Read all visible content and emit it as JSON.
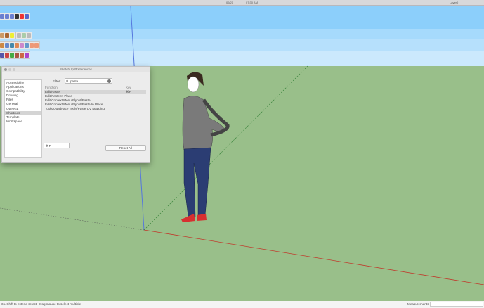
{
  "menubar": {
    "date": "09/21",
    "time": "07:30 AM",
    "layer": "Layer0"
  },
  "colors": {
    "sky_top": "#8ccffb",
    "ground": "#99bf8a",
    "blue_axis": "#5577dd",
    "red_axis": "#c0392b",
    "green_axis": "#2e7d32"
  },
  "dialog": {
    "title": "SketchUp Preferences",
    "categories": [
      "Accessibility",
      "Applications",
      "Compatibility",
      "Drawing",
      "Files",
      "General",
      "OpenGL",
      "Shortcuts",
      "Template",
      "Workspace"
    ],
    "selected_category": "Shortcuts",
    "filter_label": "Filter:",
    "filter_value": "paste",
    "columns": {
      "function": "Function",
      "key": "Key"
    },
    "rows": [
      {
        "function": "Edit/Paste",
        "key": "⌘P"
      },
      {
        "function": "Edit/Paste In Place",
        "key": ""
      },
      {
        "function": "Edit/Context Menu Flyout/Paste",
        "key": ""
      },
      {
        "function": "Edit/Context Menu Flyout/Paste In Place",
        "key": ""
      },
      {
        "function": "Tools/QuadFace Tools/Paste UV Mapping",
        "key": ""
      }
    ],
    "key_value": "⌘P",
    "reset_label": "Reset All"
  },
  "status": {
    "text": "cts. Shift to extend select. Drag mouse to select multiple.",
    "measurements_label": "Measurements"
  }
}
